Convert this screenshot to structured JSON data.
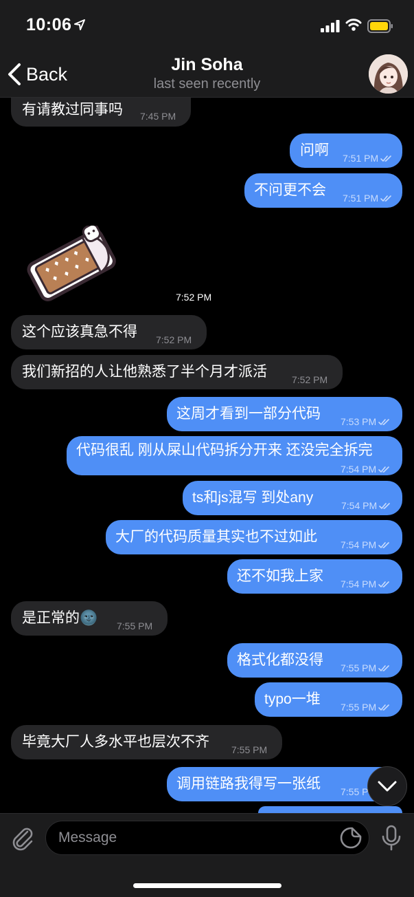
{
  "status_bar": {
    "time": "10:06"
  },
  "header": {
    "back_label": "Back",
    "contact_name": "Jin Soha",
    "contact_status": "last seen recently"
  },
  "messages": [
    {
      "id": 0,
      "direction": "in",
      "text": "有请教过同事吗",
      "time": "7:45 PM"
    },
    {
      "id": 1,
      "direction": "out",
      "text": "问啊",
      "time": "7:51 PM",
      "read": true
    },
    {
      "id": 2,
      "direction": "out",
      "text": "不问更不会",
      "time": "7:51 PM",
      "read": true
    },
    {
      "id": 3,
      "direction": "in",
      "type": "sticker",
      "sticker": "chocolate-bar-sticker",
      "time": "7:52 PM"
    },
    {
      "id": 4,
      "direction": "in",
      "text": "这个应该真急不得",
      "time": "7:52 PM"
    },
    {
      "id": 5,
      "direction": "in",
      "text": "我们新招的人让他熟悉了半个月才派活",
      "time": "7:52 PM"
    },
    {
      "id": 6,
      "direction": "out",
      "text": "这周才看到一部分代码",
      "time": "7:53 PM",
      "read": true
    },
    {
      "id": 7,
      "direction": "out",
      "text": "代码很乱 刚从屎山代码拆分开来 还没完全拆完",
      "time": "7:54 PM",
      "read": true
    },
    {
      "id": 8,
      "direction": "out",
      "text": "ts和js混写 到处any",
      "time": "7:54 PM",
      "read": true
    },
    {
      "id": 9,
      "direction": "out",
      "text": "大厂的代码质量其实也不过如此",
      "time": "7:54 PM",
      "read": true
    },
    {
      "id": 10,
      "direction": "out",
      "text": "还不如我上家",
      "time": "7:54 PM",
      "read": true
    },
    {
      "id": 11,
      "direction": "in",
      "text": "是正常的🌚",
      "time": "7:55 PM"
    },
    {
      "id": 12,
      "direction": "out",
      "text": "格式化都没得",
      "time": "7:55 PM",
      "read": true
    },
    {
      "id": 13,
      "direction": "out",
      "text": "typo一堆",
      "time": "7:55 PM",
      "read": true
    },
    {
      "id": 14,
      "direction": "in",
      "text": "毕竟大厂人多水平也层次不齐",
      "time": "7:55 PM"
    },
    {
      "id": 15,
      "direction": "out",
      "text": "调用链路我得写一张纸",
      "time": "7:55 PM",
      "read": true
    }
  ],
  "composer": {
    "placeholder": "Message"
  },
  "icons": {
    "location": "location-arrow-icon",
    "signal": "cellular-signal-icon",
    "wifi": "wifi-icon",
    "battery": "battery-icon",
    "back": "chevron-left-icon",
    "scroll_down": "chevron-down-icon",
    "attach": "paperclip-icon",
    "sticker": "sticker-icon",
    "mic": "microphone-icon"
  },
  "colors": {
    "outgoing_bubble": "#4f8ff6",
    "incoming_bubble": "#262628",
    "battery_fill": "#ffd60a"
  }
}
